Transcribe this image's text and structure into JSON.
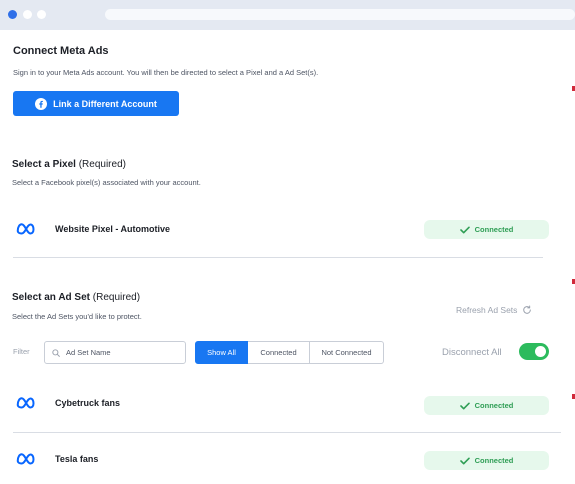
{
  "connect": {
    "title": "Connect Meta Ads",
    "subtitle": "Sign in to your Meta Ads account. You will then be directed to select a Pixel and a Ad Set(s).",
    "link_button": "Link a Different Account"
  },
  "pixel": {
    "title": "Select a Pixel",
    "required": "(Required)",
    "subtitle": "Select a Facebook pixel(s) associated with your account.",
    "name": "Website Pixel - Automotive",
    "status": "Connected"
  },
  "adset": {
    "title": "Select an Ad Set",
    "required": "(Required)",
    "subtitle": "Select the Ad Sets you'd like to protect.",
    "refresh": "Refresh Ad Sets",
    "filter_label": "Filter",
    "search_placeholder": "Ad Set Name",
    "segments": [
      "Show All",
      "Connected",
      "Not Connected"
    ],
    "disconnect_all": "Disconnect All",
    "items": [
      {
        "name": "Cybetruck fans",
        "status": "Connected"
      },
      {
        "name": "Tesla fans",
        "status": "Connected"
      }
    ]
  },
  "colors": {
    "primary": "#1877f2",
    "success": "#2cbb5d",
    "success_bg": "#e6f8ec",
    "meta_blue": "#0866ff"
  },
  "icons": {
    "meta": "meta-logo-icon",
    "facebook": "facebook-icon",
    "check": "check-icon",
    "refresh": "refresh-icon",
    "search": "search-icon"
  }
}
